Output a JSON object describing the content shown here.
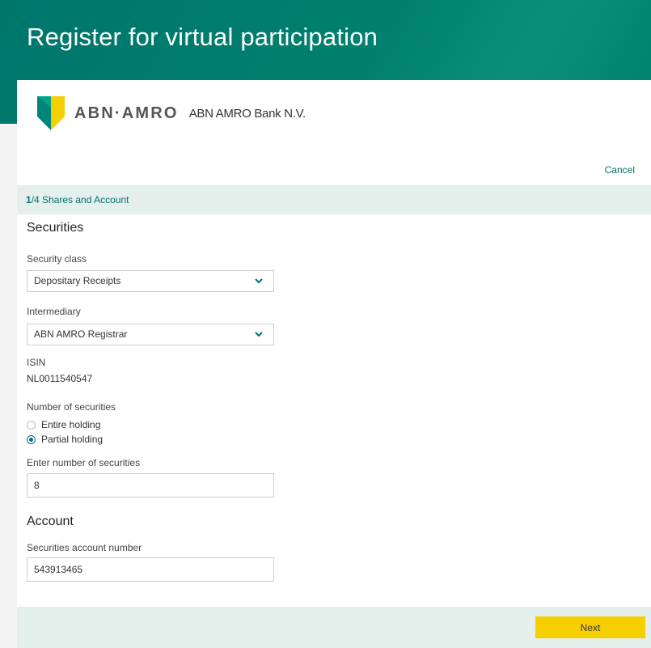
{
  "header": {
    "title": "Register for virtual participation"
  },
  "brand": {
    "wordmark": "ABN·AMRO",
    "company_name": "ABN AMRO Bank N.V."
  },
  "actions": {
    "cancel_label": "Cancel",
    "next_label": "Next"
  },
  "step": {
    "current": "1",
    "rest": "/4 Shares and Account"
  },
  "securities": {
    "heading": "Securities",
    "security_class": {
      "label": "Security class",
      "value": "Depositary Receipts"
    },
    "intermediary": {
      "label": "Intermediary",
      "value": "ABN AMRO Registrar"
    },
    "isin": {
      "label": "ISIN",
      "value": "NL0011540547"
    },
    "number_of_securities": {
      "label": "Number of securities",
      "options": [
        {
          "label": "Entire holding",
          "selected": false
        },
        {
          "label": "Partial holding",
          "selected": true
        }
      ]
    },
    "enter_number": {
      "label": "Enter number of securities",
      "value": "8"
    }
  },
  "account": {
    "heading": "Account",
    "account_number": {
      "label": "Securities account number",
      "value": "543913465"
    }
  },
  "colors": {
    "brand_green": "#00766b",
    "accent_yellow": "#f6cf01",
    "step_bg": "#e5efec"
  }
}
